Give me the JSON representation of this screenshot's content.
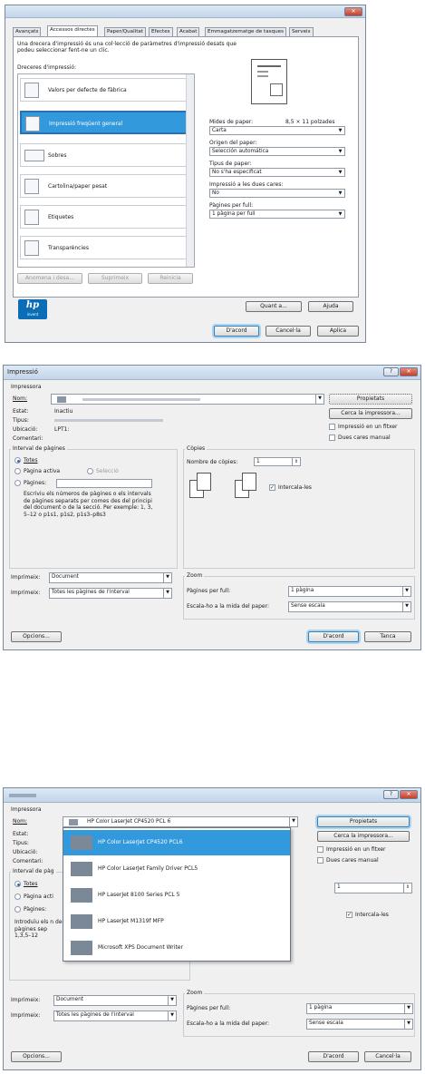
{
  "w1": {
    "tabs": [
      "Avançats",
      "Accessos directes",
      "Paper/Qualitat",
      "Efectes",
      "Acabat",
      "Emmagatzematge de tasques",
      "Serveis"
    ],
    "intro": "Una drecera d'impressió és una col·lecció de paràmetres d'impressió desats que podeu seleccionar fent-ne un clic.",
    "shortcuts_label": "Dreceres d'impressió:",
    "shortcuts": [
      "Valors per defecte de fàbrica",
      "Impressió freqüent general",
      "Sobres",
      "Cartolina/paper pesat",
      "Etiquetes",
      "Transparències"
    ],
    "paper_size_label": "Mides de paper:",
    "paper_size_value": "8,5 × 11 polzades",
    "paper_size": "Carta",
    "paper_source_label": "Origen del paper:",
    "paper_source": "Selección automática",
    "paper_type_label": "Tipus de paper:",
    "paper_type": "No s'ha especificat",
    "duplex_label": "Impressió a les dues cares:",
    "duplex": "No",
    "pages_per_sheet_label": "Pàgines per full:",
    "pages_per_sheet": "1 pàgina per full",
    "save_as": "Anomena i desa...",
    "delete": "Suprimeix",
    "reset": "Reinicia",
    "about": "Quant a...",
    "help": "Ajuda",
    "ok": "D'acord",
    "cancel": "Cancel·la",
    "apply": "Aplica",
    "brand_logo": "hp",
    "brand_tag": "invent"
  },
  "w2": {
    "title": "Impressió",
    "printer_group": "Impressora",
    "name_label": "Nom:",
    "status_label": "Estat:",
    "status": "Inactiu",
    "type_label": "Tipus:",
    "location_label": "Ubicació:",
    "location": "LPT1:",
    "comment_label": "Comentari:",
    "properties": "Propietats",
    "find_printer": "Cerca la impressora...",
    "print_to_file": "Impressió en un fitxer",
    "manual_duplex": "Dues cares manual",
    "range_group": "Interval de pàgines",
    "all": "Totes",
    "current_page": "Pàgina activa",
    "selection": "Selecció",
    "pages": "Pàgines:",
    "pages_help": "Escriviu els números de pàgines o els intervals de pàgines separats per comes des del principi del document o de la secció. Per exemple: 1, 3, 5–12 o p1s1, p1s2, p1s3–p8s3",
    "copies_group": "Còpies",
    "copies_label": "Nombre de còpies:",
    "copies": "1",
    "collate": "Intercala-les",
    "print_what_label": "Imprimeix:",
    "print_what": "Document",
    "print_label": "Imprimeix:",
    "print": "Totes les pàgines de l'interval",
    "zoom_group": "Zoom",
    "pps_label": "Pàgines per full:",
    "pps": "1 pàgina",
    "scale_label": "Escala-ho a la mida del paper:",
    "scale": "Sense escala",
    "options": "Opcions...",
    "ok": "D'acord",
    "close": "Tanca",
    "help_btn": "?"
  },
  "w3": {
    "printer_group": "Impressora",
    "name_label": "Nom:",
    "name": "HP Color LaserJet CP4520 PCL 6",
    "status_label": "Estat:",
    "type_label": "Tipus:",
    "location_label": "Ubicació:",
    "comment_label": "Comentari:",
    "printers": [
      "HP Color LaserJet CP4520 PCL6",
      "HP Color LaserJet Family Driver PCL5",
      "HP LaserJet 8100 Series PCL 5",
      "HP LaserJet M1319f MFP",
      "Microsoft XPS Document Writer"
    ],
    "properties": "Propietats",
    "find_printer": "Cerca la impressora...",
    "print_to_file": "Impressió en un fitxer",
    "manual_duplex": "Dues cares manual",
    "range_group": "Interval de pàg",
    "all": "Totes",
    "current_page": "Pàgina acti",
    "pages": "Pàgines:",
    "pages_help": "Introduïu els n de pàgines sep 1,3,5–12",
    "copies": "1",
    "collate": "Intercala-les",
    "print_what_label": "Imprimeix:",
    "print_what": "Document",
    "print_label": "Imprimeix:",
    "print": "Totes les pàgines de l'interval",
    "zoom_group": "Zoom",
    "pps_label": "Pàgines per full:",
    "pps": "1 pàgina",
    "scale_label": "Escala-ho a la mida del paper:",
    "scale": "Sense escala",
    "options": "Opcions...",
    "ok": "D'acord",
    "cancel": "Cancel·la",
    "help_btn": "?"
  }
}
